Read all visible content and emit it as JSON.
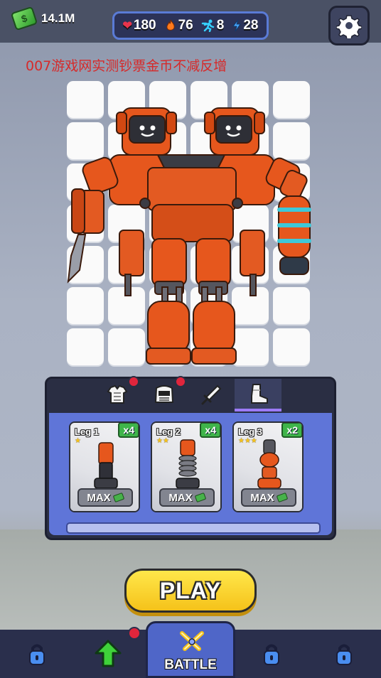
{
  "currency": {
    "cash": "14.1M"
  },
  "stats": [
    {
      "icon": "heart-icon",
      "symbol": "❤",
      "value": "180",
      "color": "#e8344c"
    },
    {
      "icon": "fire-icon",
      "symbol": "🔥",
      "value": "76",
      "color": "#ff7a1c"
    },
    {
      "icon": "speed-icon",
      "symbol": "🏃",
      "value": "8",
      "color": "#36d0ff"
    },
    {
      "icon": "energy-icon",
      "symbol": "⚡",
      "value": "28",
      "color": "#4aa8ff"
    }
  ],
  "watermark": "007游戏网实测钞票金币不减反增",
  "tabs": [
    {
      "name": "tab-armor",
      "icon": "armor-icon",
      "badge": true,
      "active": false
    },
    {
      "name": "tab-head",
      "icon": "helmet-icon",
      "badge": true,
      "active": false
    },
    {
      "name": "tab-weapon",
      "icon": "sword-icon",
      "badge": false,
      "active": false
    },
    {
      "name": "tab-legs",
      "icon": "boot-icon",
      "badge": false,
      "active": true
    }
  ],
  "cards": [
    {
      "title": "Leg 1",
      "stars": "★",
      "count": "x4",
      "button": "MAX"
    },
    {
      "title": "Leg 2",
      "stars": "★★",
      "count": "x4",
      "button": "MAX"
    },
    {
      "title": "Leg 3",
      "stars": "★★★",
      "count": "x2",
      "button": "MAX"
    }
  ],
  "play_button": "PLAY",
  "nav": {
    "battle": "BATTLE"
  },
  "colors": {
    "robot_orange": "#e6571d",
    "panel_blue": "#5f75d8",
    "play_yellow": "#f5c21a"
  }
}
